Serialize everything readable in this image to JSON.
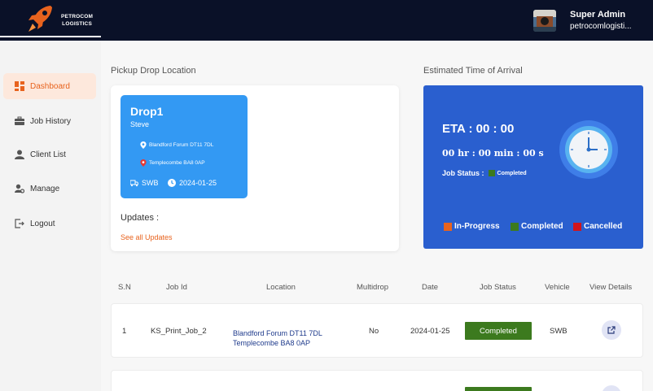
{
  "brand": {
    "line1": "PETROCOM",
    "line2": "LOGISTICS",
    "accent": "#e8631e",
    "topbar_color": "#0a1128"
  },
  "user": {
    "name": "Super Admin",
    "org": "petrocomlogisti..."
  },
  "sidebar": {
    "items": [
      {
        "label": "Dashboard",
        "icon": "dashboard-icon",
        "active": true
      },
      {
        "label": "Job History",
        "icon": "briefcase-icon"
      },
      {
        "label": "Client List",
        "icon": "user-icon"
      },
      {
        "label": "Manage",
        "icon": "user-settings-icon"
      },
      {
        "label": "Logout",
        "icon": "logout-icon"
      }
    ]
  },
  "pickup": {
    "section_title": "Pickup Drop Location",
    "card": {
      "title": "Drop1",
      "client": "Steve",
      "from": "Blandford Forum DT11 7DL",
      "to": "Templecombe BA8 0AP",
      "vehicle": "SWB",
      "date": "2024-01-25"
    },
    "updates_label": "Updates :",
    "updates_link": "See all Updates"
  },
  "eta": {
    "section_title": "Estimated Time of Arrival",
    "title": "ETA : 00 : 00",
    "time": "00 hr :  00 min :  00 s",
    "status_label": "Job Status :",
    "status_value": "Completed",
    "legend": [
      {
        "label": "In-Progress",
        "color": "#e8631e"
      },
      {
        "label": "Completed",
        "color": "#3c7a1e"
      },
      {
        "label": "Cancelled",
        "color": "#d0141c"
      }
    ],
    "panel_color": "#2a5fcf"
  },
  "table": {
    "headers": [
      "S.N",
      "Job Id",
      "Location",
      "Multidrop",
      "Date",
      "Job Status",
      "Vehicle",
      "View Details"
    ],
    "rows": [
      {
        "sn": "1",
        "job_id": "KS_Print_Job_2",
        "location_from": "Blandford Forum DT11 7DL",
        "location_to": "Templecombe BA8 0AP",
        "multidrop": "No",
        "date": "2024-01-25",
        "status": "Completed",
        "vehicle": "SWB"
      }
    ]
  }
}
